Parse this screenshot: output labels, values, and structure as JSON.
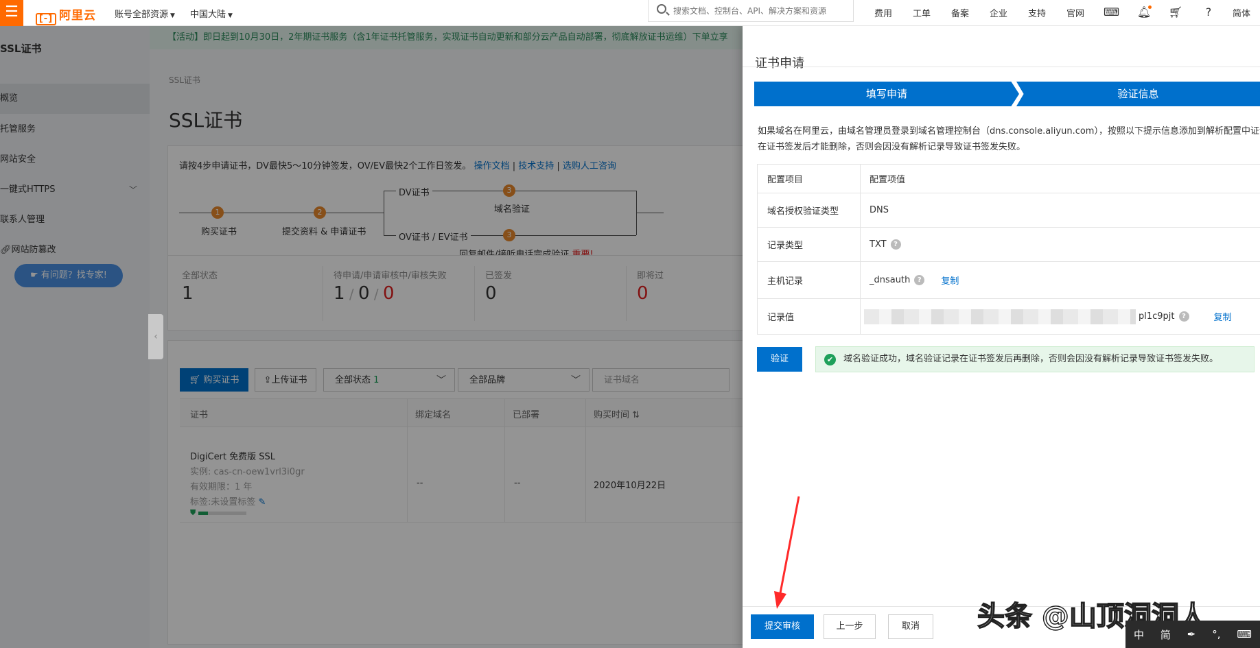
{
  "topbar": {
    "logo_text": "阿里云",
    "logo_mark": "[-]",
    "account_dropdown": "账号全部资源",
    "region_dropdown": "中国大陆",
    "search_placeholder": "搜索文档、控制台、API、解决方案和资源",
    "nav": [
      "费用",
      "工单",
      "备案",
      "企业",
      "支持",
      "官网"
    ],
    "lang": "简体",
    "icons": [
      "terminal-icon",
      "bell-icon",
      "cart-icon",
      "help-icon"
    ]
  },
  "sidebar": {
    "title": "SSL证书",
    "items": [
      "概览",
      "托管服务",
      "网站安全",
      "一键式HTTPS",
      "联系人管理",
      "网站防篡改"
    ],
    "help_button": "有问题？找专家!"
  },
  "main": {
    "banner": "【活动】即日起到10月30日，2年期证书服务（含1年证书托管服务，实现证书自动更新和部分云产品自动部署，彻底解放证书运维）下单立享",
    "breadcrumb": "SSL证书",
    "title": "SSL证书",
    "tip": "请按4步申请证书，DV最快5～10分钟签发，OV/EV最快2个工作日签发。",
    "tip_links": [
      "操作文档",
      "技术支持",
      "选购人工咨询"
    ],
    "flow": {
      "step1": "购买证书",
      "step2": "提交资料 & 申请证书",
      "dv_branch": "DV证书",
      "ov_branch": "OV证书 / EV证书",
      "dv_step": "域名验证",
      "ov_step": "回复邮件/接听电话完成验证",
      "important": "重要!",
      "badges": [
        "1",
        "2",
        "3",
        "3"
      ]
    },
    "stats": [
      {
        "label": "全部状态",
        "value": "1"
      },
      {
        "label": "待申请/申请审核中/审核失败",
        "value_a": "1",
        "value_b": "0",
        "value_c": "0"
      },
      {
        "label": "已签发",
        "value": "0"
      },
      {
        "label": "即将过",
        "value": "0"
      }
    ],
    "toolbar": {
      "buy": "购买证书",
      "upload": "上传证书",
      "status_select": "全部状态",
      "status_count": "1",
      "brand_select": "全部品牌",
      "domain_placeholder": "证书域名"
    },
    "table": {
      "headers": [
        "证书",
        "绑定域名",
        "已部署",
        "购买时间"
      ],
      "row": {
        "name": "DigiCert 免费版 SSL",
        "instance": "实例: cas-cn-oew1vrl3i0gr",
        "validity": "有效期限：1 年",
        "tag": "标签:未设置标签",
        "domain": "--",
        "deployed": "--",
        "purchase_date": "2020年10月22日"
      }
    }
  },
  "drawer": {
    "title": "证书申请",
    "wizard": [
      "填写申请",
      "验证信息"
    ],
    "note": "如果域名在阿里云，由域名管理员登录到域名管理控制台（dns.console.aliyun.com），按照以下提示信息添加到解析配置中证记录在证书签发后才能删除，否则会因没有解析记录导致证书签发失败。",
    "table": {
      "headers": [
        "配置项目",
        "配置项值"
      ],
      "rows": [
        {
          "key": "域名授权验证类型",
          "value": "DNS"
        },
        {
          "key": "记录类型",
          "value": "TXT"
        },
        {
          "key": "主机记录",
          "value": "_dnsauth"
        },
        {
          "key": "记录值",
          "value": "pl1c9pjt"
        }
      ],
      "copy": "复制"
    },
    "verify_button": "验证",
    "success_msg": "域名验证成功，域名验证记录在证书签发后再删除，否则会因没有解析记录导致证书签发失败。",
    "footer": {
      "submit": "提交审核",
      "prev": "上一步",
      "cancel": "取消"
    }
  },
  "watermark": "头条 @山顶洞洞人",
  "ime": [
    "中",
    "简"
  ]
}
